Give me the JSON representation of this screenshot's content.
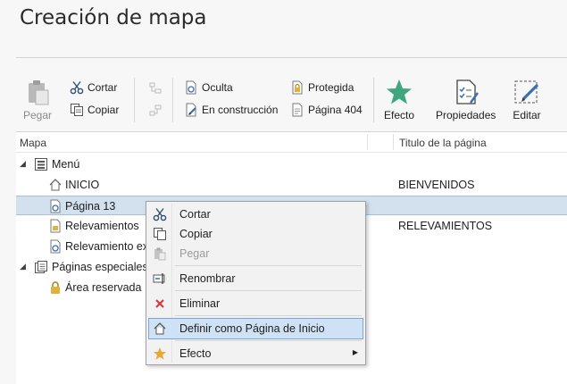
{
  "page": {
    "title": "Creación de mapa"
  },
  "toolbar": {
    "paste_label": "Pegar",
    "cut_label": "Cortar",
    "copy_label": "Copiar",
    "hidden_label": "Oculta",
    "construction_label": "En construcción",
    "protected_label": "Protegida",
    "page404_label": "Página 404",
    "effect_label": "Efecto",
    "properties_label": "Propiedades",
    "edit_label": "Editar"
  },
  "tree": {
    "col_map": "Mapa",
    "col_title": "Titulo de la página",
    "rows": [
      {
        "label": "Menú",
        "title": ""
      },
      {
        "label": "INICIO",
        "title": "BIENVENIDOS"
      },
      {
        "label": "Página 13",
        "title": ""
      },
      {
        "label": "Relevamientos",
        "title": "RELEVAMIENTOS"
      },
      {
        "label": "Relevamiento ex",
        "title": ""
      },
      {
        "label": "Páginas especiales",
        "title": ""
      },
      {
        "label": "Área reservada",
        "title": ""
      }
    ]
  },
  "context_menu": {
    "items": [
      {
        "label": "Cortar",
        "icon": "scissors-icon"
      },
      {
        "label": "Copiar",
        "icon": "copy-icon"
      },
      {
        "label": "Pegar",
        "icon": "paste-icon"
      },
      {
        "label": "Renombrar",
        "icon": "rename-icon"
      },
      {
        "label": "Eliminar",
        "icon": "delete-x-icon"
      },
      {
        "label": "Definir como Página de Inicio",
        "icon": "home-icon"
      },
      {
        "label": "Efecto",
        "icon": "star-icon"
      }
    ]
  },
  "colors": {
    "accent_star": "#3fa77e",
    "selection": "#d3e0ee",
    "highlight": "#cfe1f5",
    "delete_red": "#d9343a",
    "lock_gold": "#e0b23c"
  }
}
